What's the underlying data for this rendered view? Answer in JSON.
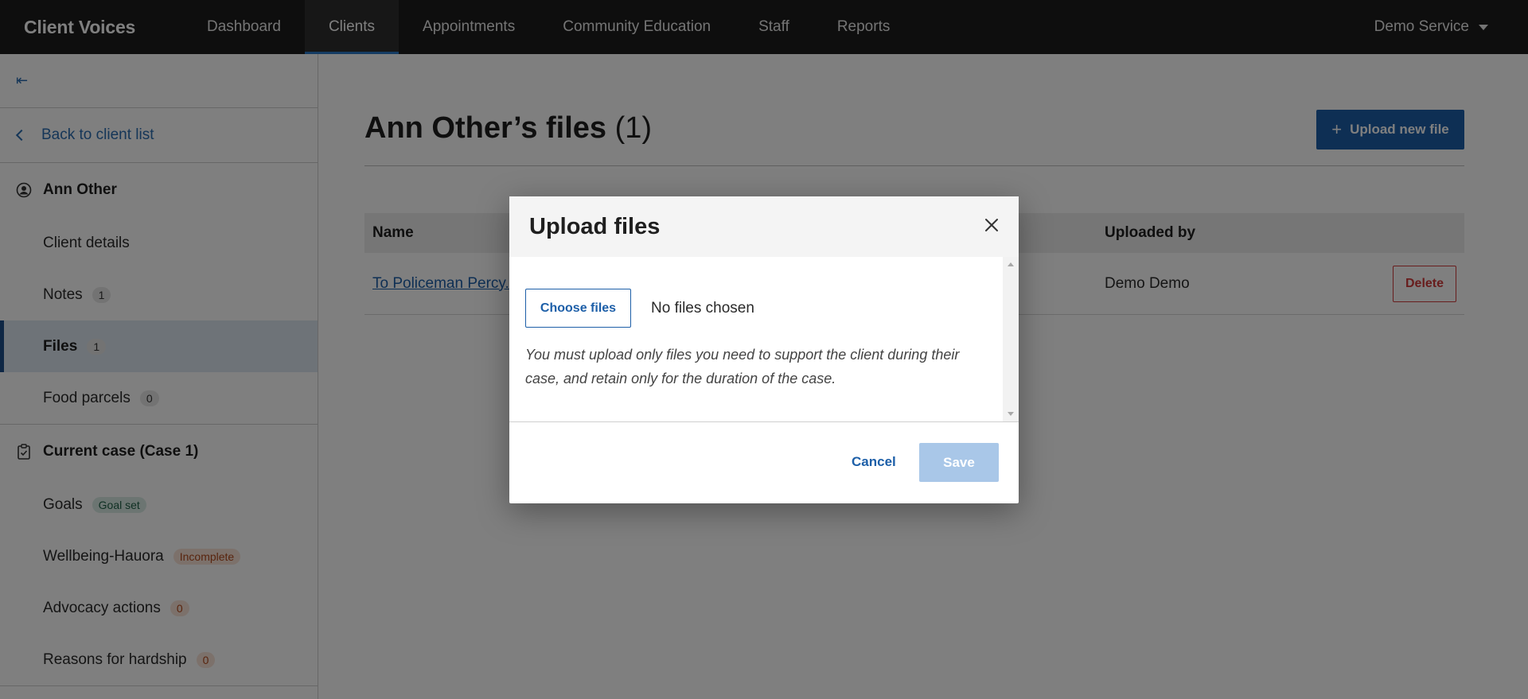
{
  "app": {
    "brand": "Client Voices",
    "nav": [
      {
        "label": "Dashboard"
      },
      {
        "label": "Clients"
      },
      {
        "label": "Appointments"
      },
      {
        "label": "Community Education"
      },
      {
        "label": "Staff"
      },
      {
        "label": "Reports"
      }
    ],
    "active_nav": "Clients",
    "service_menu": "Demo Service"
  },
  "sidebar": {
    "collapse_icon": "collapse-left-icon",
    "back_label": "Back to client list",
    "client_section": {
      "title": "Ann Other",
      "icon": "user-circle-icon",
      "items": [
        {
          "label": "Client details"
        },
        {
          "label": "Notes",
          "badge": "1"
        },
        {
          "label": "Files",
          "badge": "1",
          "active": true
        },
        {
          "label": "Food parcels",
          "badge": "0"
        }
      ]
    },
    "case_section": {
      "title": "Current case (Case 1)",
      "icon": "clipboard-icon",
      "items": [
        {
          "label": "Goals",
          "badge": "Goal set"
        },
        {
          "label": "Wellbeing-Hauora",
          "badge": "Incomplete"
        },
        {
          "label": "Advocacy actions",
          "badge": "0"
        },
        {
          "label": "Reasons for hardship",
          "badge": "0"
        }
      ]
    }
  },
  "main": {
    "title": "Ann Other’s files",
    "count": "(1)",
    "upload_button": "Upload new file",
    "table": {
      "headers": {
        "name": "Name",
        "uploaded_by": "Uploaded by"
      },
      "rows": [
        {
          "name": "To Policeman Percy.",
          "uploaded_by": "Demo Demo",
          "action": "Delete"
        }
      ]
    }
  },
  "modal": {
    "title": "Upload files",
    "choose_button": "Choose files",
    "no_files": "No files chosen",
    "hint": "You must upload only files you need to support the client during their case, and retain only for the duration of the case.",
    "cancel": "Cancel",
    "save": "Save"
  },
  "colors": {
    "nav_bg": "#1c1c1c",
    "accent": "#1d5fa8",
    "danger": "#d03a3a",
    "save_disabled": "#a9c7e8"
  }
}
